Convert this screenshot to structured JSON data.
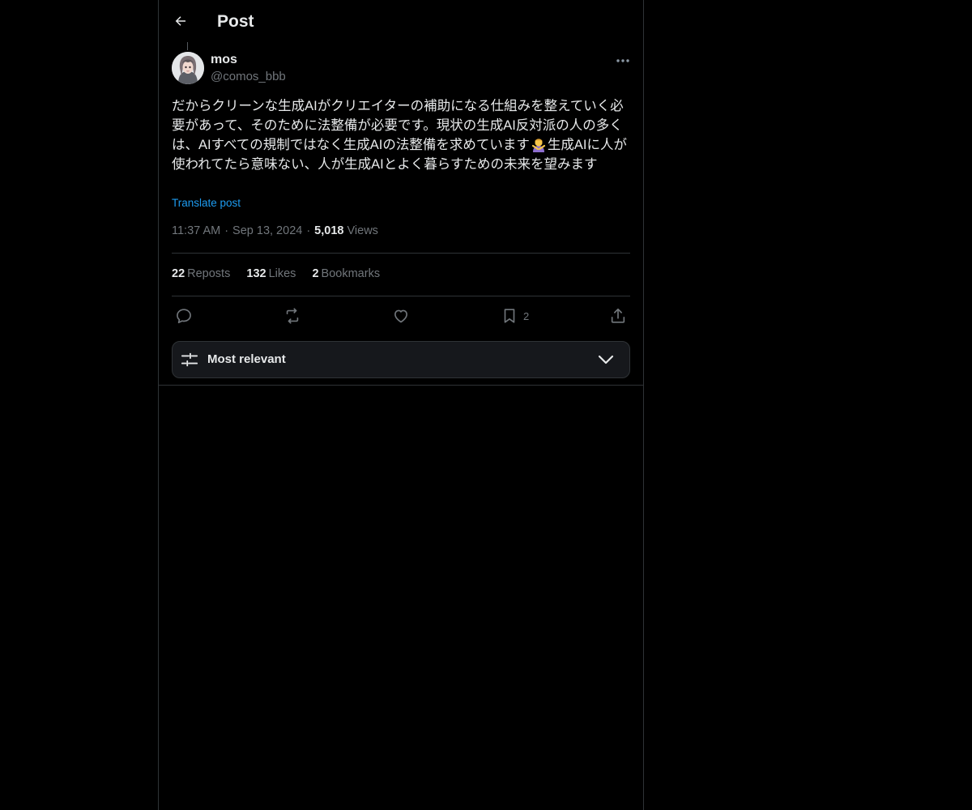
{
  "header": {
    "title": "Post",
    "back_icon": "arrow-left-icon"
  },
  "post": {
    "author": {
      "name": "mos",
      "handle": "@comos_bbb"
    },
    "text_part1": "だからクリーンな生成AIがクリエイターの補助になる仕組みを整えていく必要があって、そのために法整備が必要です。現状の生成AI反対派の人の多くは、AIすべての規制ではなく生成AIの法整備を求めています",
    "emoji": "🙅‍♀️",
    "text_part2": "生成AIに人が使われてたら意味ない、人が生成AIとよく暮らすための未来を望みます",
    "translate_label": "Translate post",
    "time": "11:37 AM",
    "date": "Sep 13, 2024",
    "views_count": "5,018",
    "views_label": "Views"
  },
  "stats": {
    "reposts_count": "22",
    "reposts_label": "Reposts",
    "likes_count": "132",
    "likes_label": "Likes",
    "bookmarks_count": "2",
    "bookmarks_label": "Bookmarks"
  },
  "actions": {
    "reply_icon": "reply-icon",
    "repost_icon": "repost-icon",
    "like_icon": "heart-icon",
    "bookmark_icon": "bookmark-icon",
    "bookmark_count": "2",
    "share_icon": "share-icon"
  },
  "sort": {
    "label": "Most relevant",
    "icon": "sliders-icon",
    "chevron": "chevron-down-icon"
  },
  "colors": {
    "background": "#000000",
    "text": "#e7e9ea",
    "muted": "#71767b",
    "link": "#1d9bf0",
    "border": "#2f3336"
  }
}
